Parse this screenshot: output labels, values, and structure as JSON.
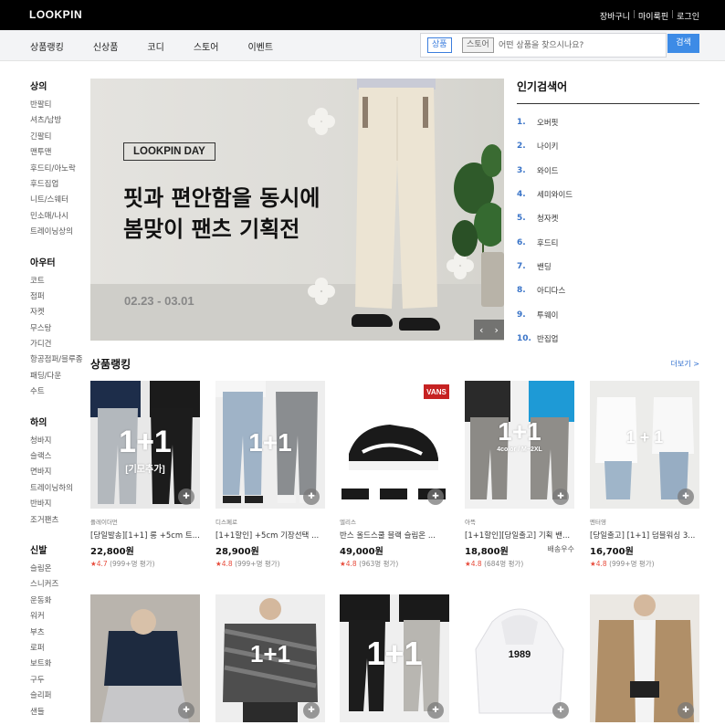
{
  "header": {
    "logo": "LOOKPIN",
    "links": [
      "장바구니",
      "마이룩핀",
      "로그인"
    ]
  },
  "nav": {
    "items": [
      "상품랭킹",
      "신상품",
      "코디",
      "스토어",
      "이벤트"
    ]
  },
  "search": {
    "chip_product": "상품",
    "chip_store": "스토어",
    "placeholder": "어떤 상품을 찾으시나요?",
    "button": "검색"
  },
  "sidebar": {
    "categories": [
      {
        "title": "상의",
        "items": [
          "반팔티",
          "셔츠/남방",
          "긴팔티",
          "맨투맨",
          "후드티/아노락",
          "후드집업",
          "니트/스웨터",
          "민소매/나시",
          "트레이닝상의"
        ]
      },
      {
        "title": "아우터",
        "items": [
          "코트",
          "점퍼",
          "자켓",
          "무스탕",
          "가디건",
          "항공점퍼/블루종",
          "패딩/다운",
          "수트"
        ]
      },
      {
        "title": "하의",
        "items": [
          "청바지",
          "슬랙스",
          "면바지",
          "트레이닝하의",
          "반바지",
          "조거팬츠"
        ]
      },
      {
        "title": "신발",
        "items": [
          "슬림온",
          "스니커즈",
          "운동화",
          "워커",
          "부츠",
          "로퍼",
          "보트화",
          "구두",
          "슬리퍼",
          "샌들"
        ]
      }
    ]
  },
  "banner": {
    "badge": "LOOKPIN DAY",
    "headline_line1": "핏과 편안함을 동시에",
    "headline_line2": "봄맞이 팬츠 기획전",
    "dates": "02.23 - 03.01",
    "prev": "‹",
    "next": "›"
  },
  "popular": {
    "title": "인기검색어",
    "items": [
      {
        "rank": "1.",
        "term": "오버핏"
      },
      {
        "rank": "2.",
        "term": "나이키"
      },
      {
        "rank": "3.",
        "term": "와이드"
      },
      {
        "rank": "4.",
        "term": "세미와이드"
      },
      {
        "rank": "5.",
        "term": "청자켓"
      },
      {
        "rank": "6.",
        "term": "후드티"
      },
      {
        "rank": "7.",
        "term": "밴딩"
      },
      {
        "rank": "8.",
        "term": "아디다스"
      },
      {
        "rank": "9.",
        "term": "투웨이"
      },
      {
        "rank": "10.",
        "term": "반집업"
      }
    ]
  },
  "ranking": {
    "title": "상품랭킹",
    "more": "더보기 >",
    "products": [
      {
        "overlay": "1+1",
        "overlay_sub": "[기모추가]",
        "brand": "플레이더먼",
        "name": "[당일발송][1+1] 롱 +5cm 트...",
        "price": "22,800원",
        "shipping": "",
        "score": "4.7",
        "reviews": "(999+명 평가)"
      },
      {
        "overlay": "1+1",
        "overlay_sub": "",
        "brand": "디스페로",
        "name": "[1+1할인] +5cm 기장선택 ...",
        "price": "28,900원",
        "shipping": "",
        "score": "4.8",
        "reviews": "(999+명 평가)"
      },
      {
        "overlay": "",
        "overlay_sub": "",
        "brand": "엘리스",
        "name": "반스 올드스쿨 블랙 슬림온 ...",
        "price": "49,000원",
        "shipping": "",
        "score": "4.8",
        "reviews": "(963명 평가)"
      },
      {
        "overlay": "1+1",
        "overlay_sub": "4color / M~2XL",
        "brand": "아뜩",
        "name": "[1+1할인][당일출고] 기획 밴...",
        "price": "18,800원",
        "shipping": "배송우수",
        "score": "4.8",
        "reviews": "(684명 평가)"
      },
      {
        "overlay": "1 + 1",
        "overlay_sub": "",
        "brand": "멘터영",
        "name": "[당일출고] [1+1] 덤블워싱 3...",
        "price": "16,700원",
        "shipping": "",
        "score": "4.8",
        "reviews": "(999+명 평가)"
      },
      {
        "overlay": "",
        "overlay_sub": "",
        "brand": "",
        "name": "",
        "price": "",
        "shipping": "",
        "score": "",
        "reviews": ""
      },
      {
        "overlay": "1+1",
        "overlay_sub": "",
        "brand": "",
        "name": "",
        "price": "",
        "shipping": "",
        "score": "",
        "reviews": ""
      },
      {
        "overlay": "1+1",
        "overlay_sub": "",
        "brand": "",
        "name": "",
        "price": "",
        "shipping": "",
        "score": "",
        "reviews": ""
      },
      {
        "overlay": "",
        "overlay_sub": "1989",
        "brand": "",
        "name": "",
        "price": "",
        "shipping": "",
        "score": "",
        "reviews": ""
      },
      {
        "overlay": "",
        "overlay_sub": "",
        "brand": "",
        "name": "",
        "price": "",
        "shipping": "",
        "score": "",
        "reviews": ""
      }
    ]
  }
}
